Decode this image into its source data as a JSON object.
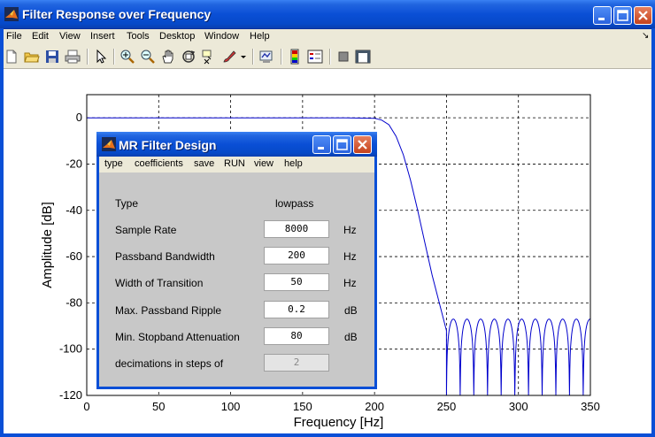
{
  "window": {
    "title": "Filter Response over Frequency",
    "menu": [
      "File",
      "Edit",
      "View",
      "Insert",
      "Tools",
      "Desktop",
      "Window",
      "Help"
    ],
    "menu_arrow": "↘"
  },
  "toolbar": {
    "icons": [
      "new-file-icon",
      "open-folder-icon",
      "save-icon",
      "print-icon",
      "pointer-icon",
      "zoom-in-icon",
      "zoom-out-icon",
      "pan-hand-icon",
      "rotate-3d-icon",
      "data-cursor-icon",
      "brush-icon",
      "link-plot-icon",
      "colorbar-icon",
      "legend-icon",
      "hide-plot-tools-icon",
      "show-plot-tools-icon"
    ]
  },
  "chart_data": {
    "type": "line",
    "title": "",
    "xlabel": "Frequency [Hz]",
    "ylabel": "Amplitude [dB]",
    "xlim": [
      0,
      350
    ],
    "ylim": [
      -120,
      10
    ],
    "xticks": [
      0,
      50,
      100,
      150,
      200,
      250,
      300,
      350
    ],
    "yticks": [
      0,
      -20,
      -40,
      -60,
      -80,
      -100,
      -120
    ],
    "grid": "dashed",
    "series": [
      {
        "color": "#0000cc",
        "description_points": {
          "passband_edge_hz": 200,
          "stopband_start_hz": 250,
          "passband_level_db": 0,
          "stopband_peak_db": -87
        },
        "x": [
          0,
          180,
          200,
          205,
          210,
          215,
          220,
          225,
          230,
          235,
          240,
          245,
          250
        ],
        "y": [
          0,
          0,
          -0.2,
          -1,
          -3,
          -8,
          -16,
          -27,
          -40,
          -54,
          -68,
          -80,
          -92
        ]
      }
    ]
  },
  "dialog": {
    "title": "MR Filter Design",
    "menu": [
      "type",
      "coefficients",
      "save",
      "RUN",
      "view",
      "help"
    ],
    "rows": [
      {
        "label": "Type",
        "value": "lowpass",
        "unit": "",
        "kind": "text"
      },
      {
        "label": "Sample Rate",
        "value": "8000",
        "unit": "Hz",
        "kind": "input"
      },
      {
        "label": "Passband Bandwidth",
        "value": "200",
        "unit": "Hz",
        "kind": "input"
      },
      {
        "label": "Width of Transition",
        "value": "50",
        "unit": "Hz",
        "kind": "input"
      },
      {
        "label": "Max. Passband Ripple",
        "value": "0.2",
        "unit": "dB",
        "kind": "input"
      },
      {
        "label": "Min. Stopband Attenuation",
        "value": "80",
        "unit": "dB",
        "kind": "input"
      },
      {
        "label": "decimations in steps of",
        "value": "2",
        "unit": "",
        "kind": "disabled"
      }
    ]
  },
  "colors": {
    "titlebar": "#0a4fd6",
    "chrome": "#ece9d8",
    "dialog_body": "#c8c8c8",
    "trace": "#0000cc"
  }
}
